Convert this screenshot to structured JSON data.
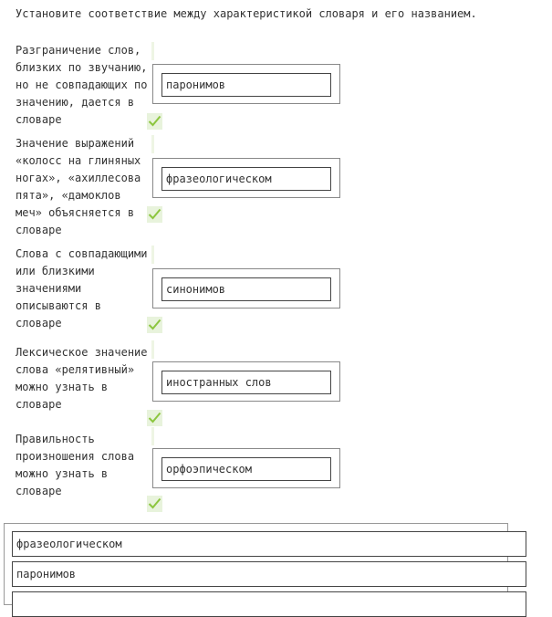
{
  "instruction": "Установите соответствие между характеристикой словаря и его названием.",
  "pairs": [
    {
      "question": "Разграничение слов, близких по звучанию, но не совпадающих по значению, дается в словаре",
      "answer": "паронимов",
      "status": "correct"
    },
    {
      "question": "Значение выражений «колосс на глиняных ногах», «ахиллесова пята», «дамоклов меч» объясняется в словаре",
      "answer": "фразеологическом",
      "status": "correct"
    },
    {
      "question": "Слова с совпадающими или близкими значениями описываются в словаре",
      "answer": "синонимов",
      "status": "correct"
    },
    {
      "question": "Лексическое значение слова «релятивный» можно узнать в словаре",
      "answer": "иностранных слов",
      "status": "correct"
    },
    {
      "question": "Правильность произношения слова можно узнать в словаре",
      "answer": "орфоэпическом",
      "status": "correct"
    }
  ],
  "answer_bank": [
    "фразеологическом",
    "паронимов",
    ""
  ],
  "colors": {
    "check": "#8cc63f",
    "check_bg": "#e8f3dc"
  },
  "icons": {
    "status": "check-icon"
  }
}
